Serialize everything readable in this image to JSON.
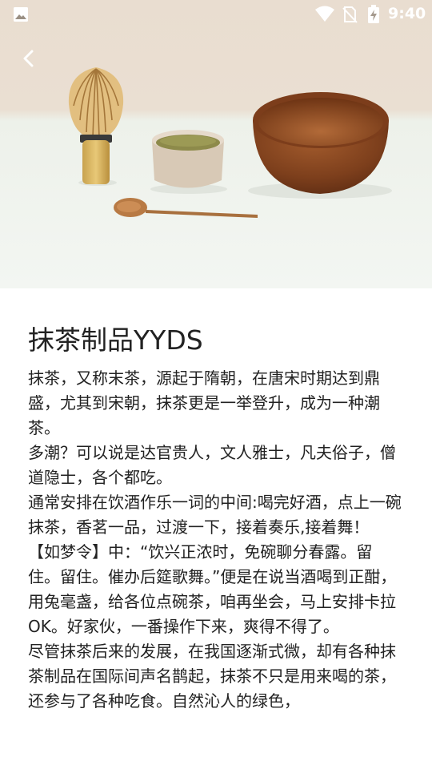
{
  "status_bar": {
    "time": "9:40"
  },
  "header": {
    "back_icon": "chevron-left-icon"
  },
  "article": {
    "title": "抹茶制品YYDS",
    "paragraphs": [
      "抹茶，又称末茶，源起于隋朝，在唐宋时期达到鼎盛，尤其到宋朝，抹茶更是一举登升，成为一种潮茶。",
      "多潮？可以说是达官贵人，文人雅士，凡夫俗子，僧道隐士，各个都吃。",
      "通常安排在饮酒作乐一词的中间:喝完好酒，点上一碗抹茶，香茗一品，过渡一下，接着奏乐,接着舞！",
      "【如梦令】中：“饮兴正浓时，免碗聊分春露。留住。留住。催办后筵歌舞。”便是在说当酒喝到正酣，用兔毫盏，给各位点碗茶，咱再坐会，马上安排卡拉OK。好家伙，一番操作下来，爽得不得了。",
      "尽管抹茶后来的发展，在我国逐渐式微，却有各种抹茶制品在国际间声名鹊起，抹茶不只是用来喝的茶，还参与了各种吃食。自然沁人的绿色，"
    ]
  },
  "colors": {
    "text": "#222222",
    "status_icons": "#ffffff"
  }
}
